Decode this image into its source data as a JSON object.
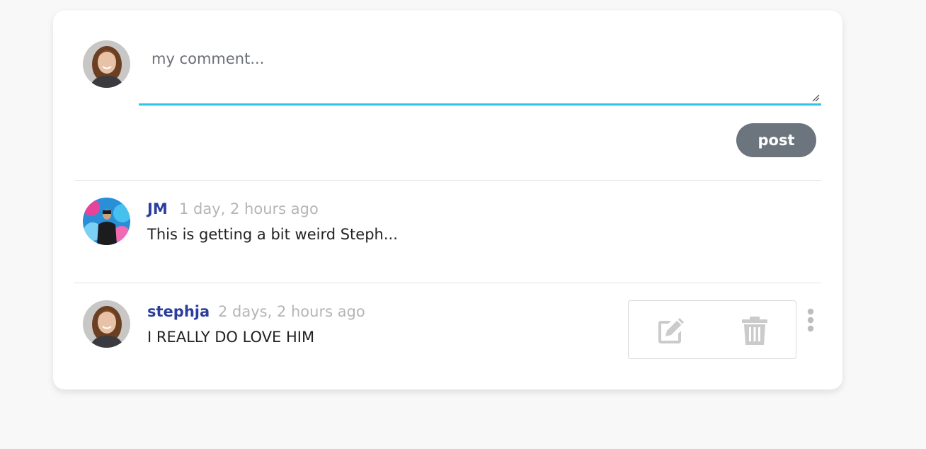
{
  "composer": {
    "placeholder": "my comment...",
    "value": "",
    "post_label": "post",
    "accent_color": "#2ec4e6"
  },
  "comments": [
    {
      "author": "JM",
      "time": "1 day, 2 hours ago",
      "text": "This is getting a bit weird Steph..."
    },
    {
      "author": "stephja",
      "time": "2 days, 2 hours ago",
      "text": "I REALLY DO LOVE HIM",
      "actions": [
        "edit-icon",
        "trash-icon"
      ],
      "more_icon": "vertical-dots-icon"
    }
  ],
  "colors": {
    "author": "#2c3e9c",
    "timestamp": "#b5b5b5",
    "post_button": "#6c757d"
  }
}
